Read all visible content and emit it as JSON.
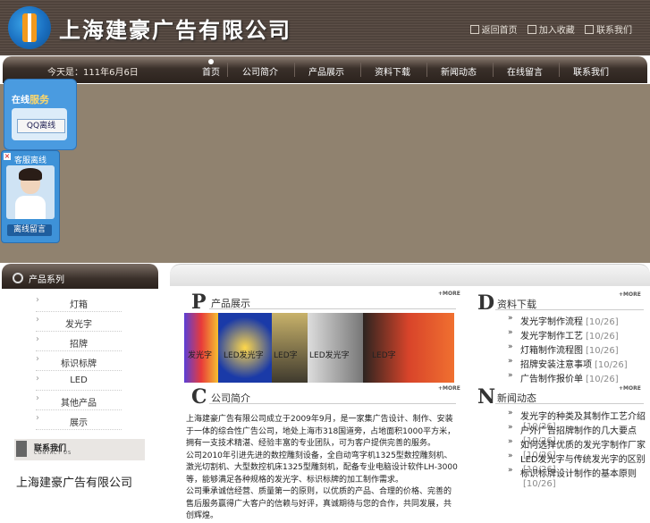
{
  "header": {
    "company_name": "上海建豪广告有限公司",
    "links": [
      "返回首页",
      "加入收藏",
      "联系我们"
    ]
  },
  "nav": {
    "date": "今天是：111年6月6日",
    "items": [
      "首页",
      "公司简介",
      "产品展示",
      "资料下载",
      "新闻动态",
      "在线留言",
      "联系我们"
    ]
  },
  "float_qq": {
    "title_a": "在线",
    "title_b": "服务",
    "button": "QQ离线"
  },
  "float_cs": {
    "title": "客服离线",
    "button": "离线留言"
  },
  "sidebar": {
    "title": "产品系列",
    "categories": [
      "灯箱",
      "发光字",
      "招牌",
      "标识标牌",
      "LED",
      "其他产品",
      "展示"
    ],
    "contact_title": "联系我们",
    "contact_sub": "CONTACT US",
    "company": "上海建豪广告有限公司"
  },
  "products": {
    "title": "产品展示",
    "more": "+MORE",
    "captions": [
      "发光字",
      "LED发光字",
      "LED字",
      "LED发光字",
      "LED字"
    ]
  },
  "intro": {
    "title": "公司简介",
    "more": "+MORE",
    "text": "上海建豪广告有限公司成立于2009年9月，是一家集广告设计、制作、安装于一体的综合性广告公司，地处上海市318国道旁，占地面积1000平方米，拥有一支技术精湛、经验丰富的专业团队，可为客户提供完善的服务。\n公司2010年引进先进的数控雕刻设备，全自动弯字机1325型数控雕刻机、激光切割机、大型数控机床1325型雕刻机，配备专业电脑设计软件LH-3000等，能够满足各种规格的发光字、标识标牌的加工制作需求。\n公司秉承诚信经营、质量第一的原则，以优质的产品、合理的价格、完善的售后服务赢得广大客户的信赖与好评，真诚期待与您的合作，共同发展，共创辉煌。"
  },
  "downloads": {
    "title": "资料下载",
    "more": "+MORE",
    "items": [
      {
        "title": "发光字制作流程",
        "date": "[10/26]"
      },
      {
        "title": "发光字制作工艺",
        "date": "[10/26]"
      },
      {
        "title": "灯箱制作流程图",
        "date": "[10/26]"
      },
      {
        "title": "招牌安装注意事项",
        "date": "[10/26]"
      },
      {
        "title": "广告制作报价单",
        "date": "[10/26]"
      }
    ]
  },
  "news": {
    "title": "新闻动态",
    "more": "+MORE",
    "items": [
      {
        "title": "发光字的种类及其制作工艺介绍",
        "date": "[10/26]"
      },
      {
        "title": "户外广告招牌制作的几大要点",
        "date": "[10/26]"
      },
      {
        "title": "如何选择优质的发光字制作厂家",
        "date": "[10/26]"
      },
      {
        "title": "LED发光字与传统发光字的区别",
        "date": "[10/26]"
      },
      {
        "title": "标识标牌设计制作的基本原则",
        "date": "[10/26]"
      }
    ]
  }
}
